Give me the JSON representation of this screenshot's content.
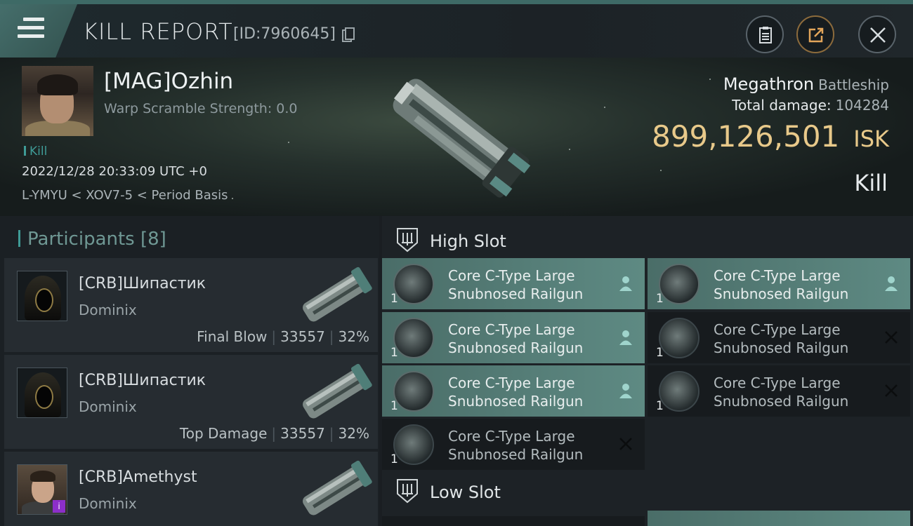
{
  "header": {
    "title": "KILL REPORT",
    "kill_id": "[ID:7960645]"
  },
  "victim": {
    "name": "[MAG]Ozhin",
    "warp_scramble": "Warp Scramble Strength: 0.0",
    "tag": "Kill",
    "date": "2022/12/28 20:33:09 UTC +0",
    "location": "L-YMYU < XOV7-5 < Period Basis",
    "ship_name": "Megathron",
    "ship_class": "Battleship",
    "total_damage_label": "Total damage:",
    "total_damage_value": "104284",
    "isk_value": "899,126,501",
    "isk_unit": "ISK",
    "result": "Kill"
  },
  "participants": {
    "heading": "Participants [8]",
    "items": [
      {
        "name": "[CRB]Шипастик",
        "ship": "Dominix",
        "role": "Final Blow",
        "damage": "33557",
        "percent": "32%"
      },
      {
        "name": "[CRB]Шипастик",
        "ship": "Dominix",
        "role": "Top Damage",
        "damage": "33557",
        "percent": "32%"
      },
      {
        "name": "[CRB]Amethyst",
        "ship": "Dominix",
        "badge": "i"
      }
    ]
  },
  "high_slot": {
    "label": "High Slot",
    "modules": [
      {
        "name": "Core C-Type Large Snubnosed Railgun",
        "qty": "1",
        "state": "online"
      },
      {
        "name": "Core C-Type Large Snubnosed Railgun",
        "qty": "1",
        "state": "online"
      },
      {
        "name": "Core C-Type Large Snubnosed Railgun",
        "qty": "1",
        "state": "online"
      },
      {
        "name": "Core C-Type Large Snubnosed Railgun",
        "qty": "1",
        "state": "destroyed"
      },
      {
        "name": "Core C-Type Large Snubnosed Railgun",
        "qty": "1",
        "state": "online"
      },
      {
        "name": "Core C-Type Large Snubnosed Railgun",
        "qty": "1",
        "state": "destroyed"
      },
      {
        "name": "Core C-Type Large Snubnosed Railgun",
        "qty": "1",
        "state": "destroyed"
      }
    ]
  },
  "low_slot": {
    "label": "Low Slot"
  },
  "colors": {
    "accent": "#3f9b96",
    "isk": "#e8c98a",
    "module_online": "#5e8a83"
  },
  "icons": [
    "menu-icon",
    "copy-icon",
    "report-icon",
    "share-icon",
    "close-icon",
    "slot-icon",
    "pilot-icon",
    "destroyed-icon"
  ]
}
